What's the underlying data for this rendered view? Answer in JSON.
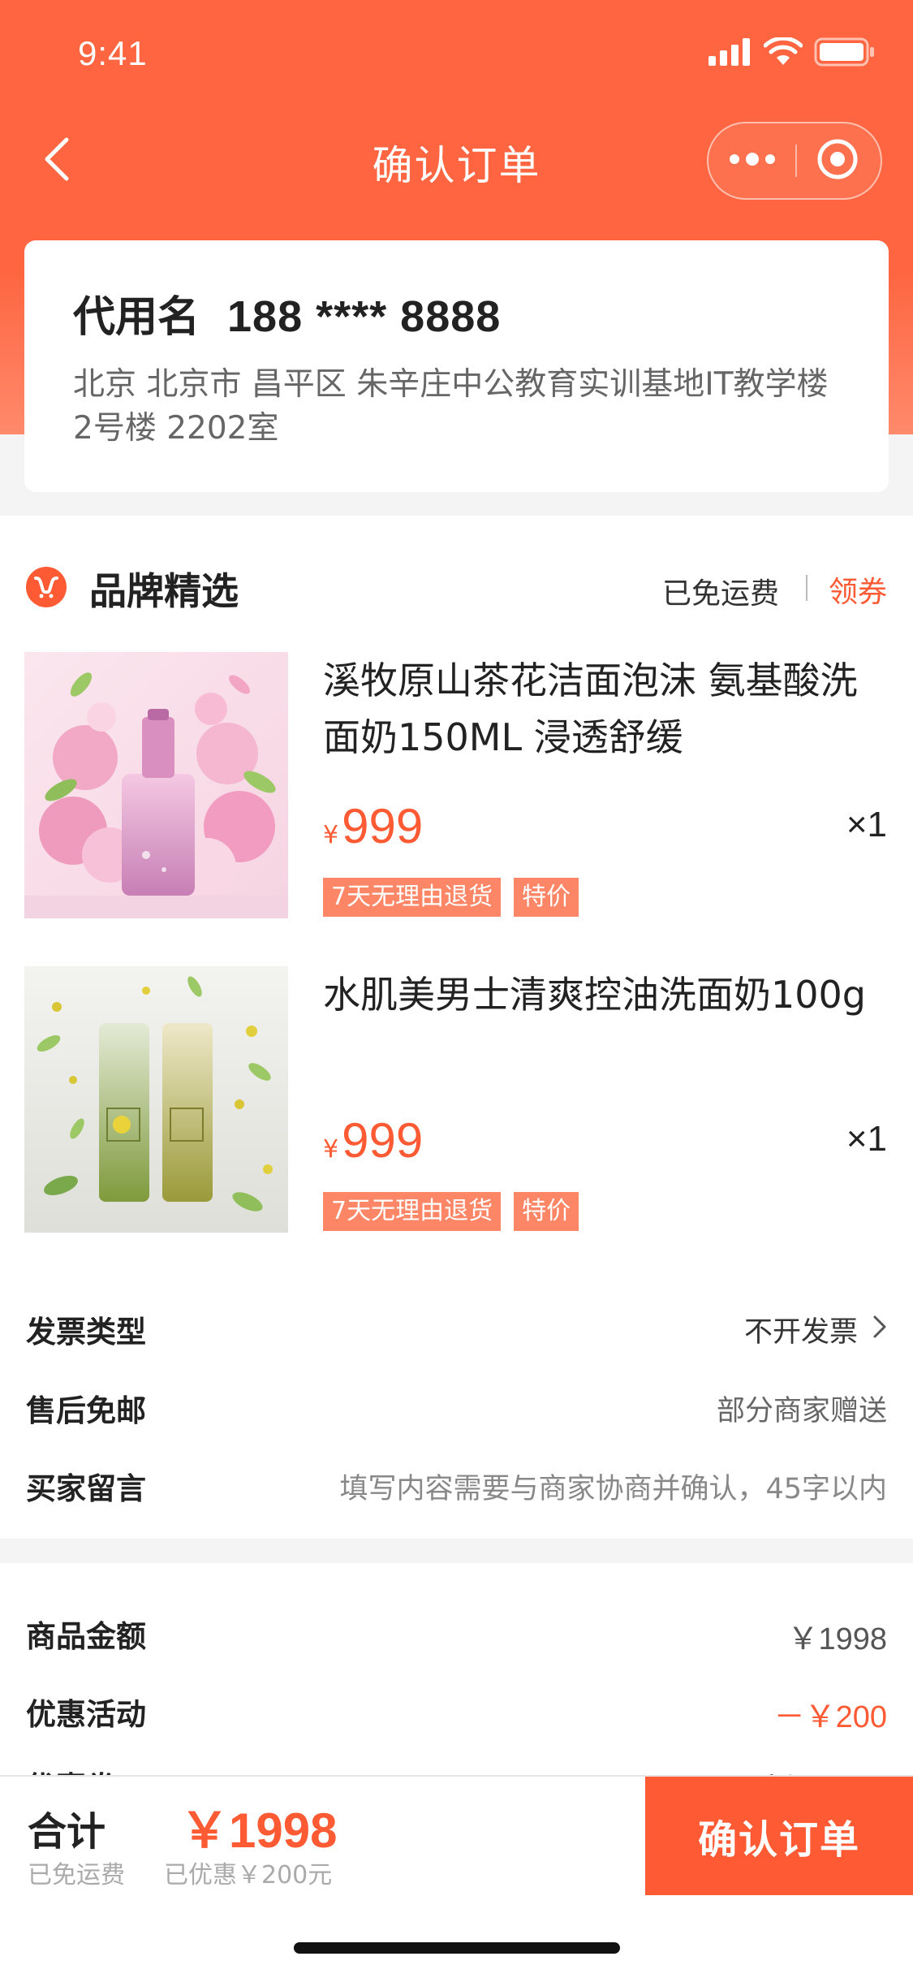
{
  "status_bar": {
    "time": "9:41"
  },
  "nav": {
    "title": "确认订单"
  },
  "address": {
    "name": "代用名",
    "phone": "188 **** 8888",
    "detail": "北京 北京市 昌平区 朱辛庄中公教育实训基地IT教学楼 2号楼 2202室"
  },
  "store": {
    "name": "品牌精选",
    "shipping_note": "已免运费",
    "coupon_link": "领券"
  },
  "products": [
    {
      "title": "溪牧原山茶花洁面泡沫 氨基酸洗面奶150ML 浸透舒缓",
      "currency": "¥",
      "price": "999",
      "qty": "×1",
      "tags": [
        "7天无理由退货",
        "特价"
      ]
    },
    {
      "title": "水肌美男士清爽控油洗面奶100g",
      "currency": "¥",
      "price": "999",
      "qty": "×1",
      "tags": [
        "7天无理由退货",
        "特价"
      ]
    }
  ],
  "info_rows": {
    "invoice": {
      "label": "发票类型",
      "value": "不开发票"
    },
    "aftersale": {
      "label": "售后免邮",
      "value": "部分商家赠送"
    },
    "note": {
      "label": "买家留言",
      "placeholder": "填写内容需要与商家协商并确认，45字以内"
    }
  },
  "summary": {
    "goods": {
      "label": "商品金额",
      "value": "￥1998"
    },
    "promo": {
      "label": "优惠活动",
      "value": "－￥200"
    },
    "coupon": {
      "label": "优惠券",
      "value": "暂无可用"
    }
  },
  "bottom_bar": {
    "total_label": "合计",
    "total_amount": "￥1998",
    "free_shipping": "已免运费",
    "saved_note": "已优惠￥200元",
    "confirm_label": "确认订单"
  },
  "colors": {
    "accent": "#fe5a34",
    "header": "#fe6540",
    "tag": "#fd8666"
  },
  "icons": [
    "back-arrow-icon",
    "more-dots-icon",
    "close-circle-icon",
    "store-logo-icon",
    "chevron-right-icon",
    "signal-icon",
    "wifi-icon",
    "battery-icon"
  ]
}
